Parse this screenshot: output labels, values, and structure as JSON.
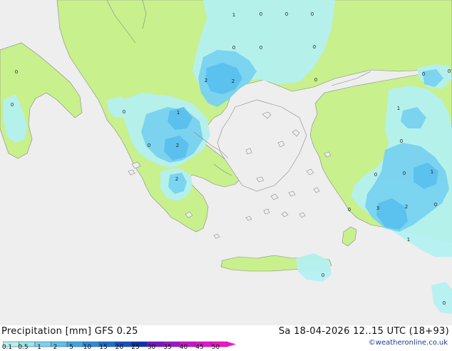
{
  "map": {
    "point_values": [
      {
        "id": "v1",
        "label": "1"
      },
      {
        "id": "v2",
        "label": "0"
      },
      {
        "id": "v3",
        "label": "0"
      },
      {
        "id": "v4",
        "label": "0"
      },
      {
        "id": "v5",
        "label": "0"
      },
      {
        "id": "v6",
        "label": "0"
      },
      {
        "id": "v7",
        "label": "0"
      },
      {
        "id": "v8",
        "label": "0"
      },
      {
        "id": "v9",
        "label": "2"
      },
      {
        "id": "v10",
        "label": "2"
      },
      {
        "id": "v11",
        "label": "0"
      },
      {
        "id": "v12",
        "label": "0"
      },
      {
        "id": "v13",
        "label": "0"
      },
      {
        "id": "v14",
        "label": "0"
      },
      {
        "id": "v15",
        "label": "1"
      },
      {
        "id": "v16",
        "label": "0"
      },
      {
        "id": "v17",
        "label": "2"
      },
      {
        "id": "v18",
        "label": "2"
      },
      {
        "id": "v19",
        "label": "1"
      },
      {
        "id": "v20",
        "label": "0"
      },
      {
        "id": "v21",
        "label": "0"
      },
      {
        "id": "v22",
        "label": "0"
      },
      {
        "id": "v23",
        "label": "1"
      },
      {
        "id": "v24",
        "label": "3"
      },
      {
        "id": "v25",
        "label": "2"
      },
      {
        "id": "v26",
        "label": "0"
      },
      {
        "id": "v27",
        "label": "0"
      },
      {
        "id": "v28",
        "label": "1"
      },
      {
        "id": "v29",
        "label": "0"
      },
      {
        "id": "v30",
        "label": "0"
      },
      {
        "id": "v31",
        "label": "0"
      }
    ]
  },
  "footer": {
    "title": "Precipitation [mm]  GFS 0.25",
    "run_info": "Sa 18-04-2026 12..15 UTC (18+93)",
    "credit": "©weatheronline.co.uk"
  },
  "legend": {
    "ticks": [
      "0.1",
      "0.5",
      "1",
      "2",
      "5",
      "10",
      "15",
      "20",
      "25",
      "30",
      "35",
      "40",
      "45",
      "50"
    ],
    "colors": [
      "#b4f0f0",
      "#96e6f0",
      "#78d2f0",
      "#5ac0ee",
      "#3ca6e6",
      "#2c8ade",
      "#1e6ed2",
      "#1450c8",
      "#0a32b4",
      "#7814c8",
      "#a014d2",
      "#c814d2",
      "#e614d2",
      "#f514c8"
    ]
  },
  "colors": {
    "sea": "#eeeeee",
    "land_dry": "#ffffff",
    "precip_trace": "#c8f08c",
    "precip_light": "#b4f0f0",
    "precip_medium": "#78d2f0",
    "precip_heavy": "#5ac0ee"
  }
}
